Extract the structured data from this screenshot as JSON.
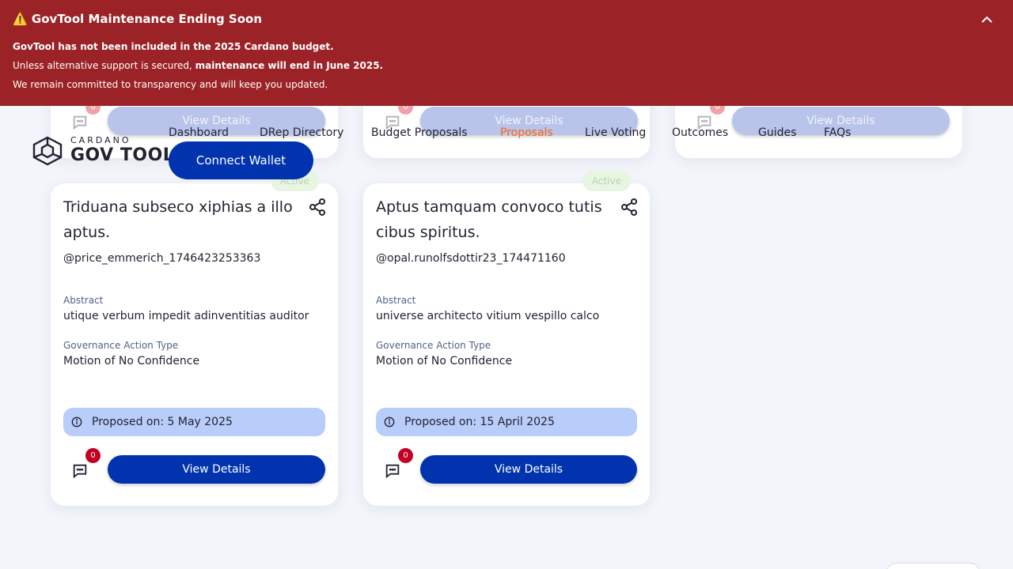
{
  "banner": {
    "title": "⚠️ GovTool Maintenance Ending Soon",
    "line1": "GovTool has not been included in the 2025 Cardano budget.",
    "line2_prefix": "Unless alternative support is secured, ",
    "line2_bold": "maintenance will end in June 2025.",
    "line3": "We remain committed to transparency and will keep you updated."
  },
  "logo": {
    "small": "CARDANO",
    "big": "GOV TOOL"
  },
  "nav": {
    "items": [
      "Dashboard",
      "DRep Directory",
      "Budget Proposals",
      "Proposals",
      "Live Voting",
      "Outcomes",
      "Guides",
      "FAQs"
    ],
    "active": "Proposals",
    "connect_label": "Connect Wallet"
  },
  "top_cards": [
    {
      "comment_count": "0",
      "button_label": "View Details"
    },
    {
      "comment_count": "0",
      "button_label": "View Details"
    },
    {
      "comment_count": "0",
      "button_label": "View Details"
    }
  ],
  "cards": [
    {
      "badge": "Active",
      "title": "Triduana subseco xiphias a illo aptus.",
      "author": "@price_emmerich_1746423253363",
      "abstract_label": "Abstract",
      "abstract": "utique verbum impedit adinventitias auditor",
      "type_label": "Governance Action Type",
      "type": "Motion of No Confidence",
      "proposed": "Proposed on: 5 May 2025",
      "comment_count": "0",
      "button_label": "View Details"
    },
    {
      "badge": "Active",
      "title": "Aptus tamquam convoco tutis cibus spiritus.",
      "author": "@opal.runolfsdottir23_174471160",
      "abstract_label": "Abstract",
      "abstract": "universe architecto vitium vespillo calco",
      "type_label": "Governance Action Type",
      "type": "Motion of No Confidence",
      "proposed": "Proposed on: 15 April 2025",
      "comment_count": "0",
      "button_label": "View Details"
    }
  ],
  "colors": {
    "banner": "#9b2226",
    "primary": "#0033ad",
    "active_nav": "#ff640a",
    "badge_bg": "#e8f5e3",
    "comment_badge": "#c20024"
  }
}
